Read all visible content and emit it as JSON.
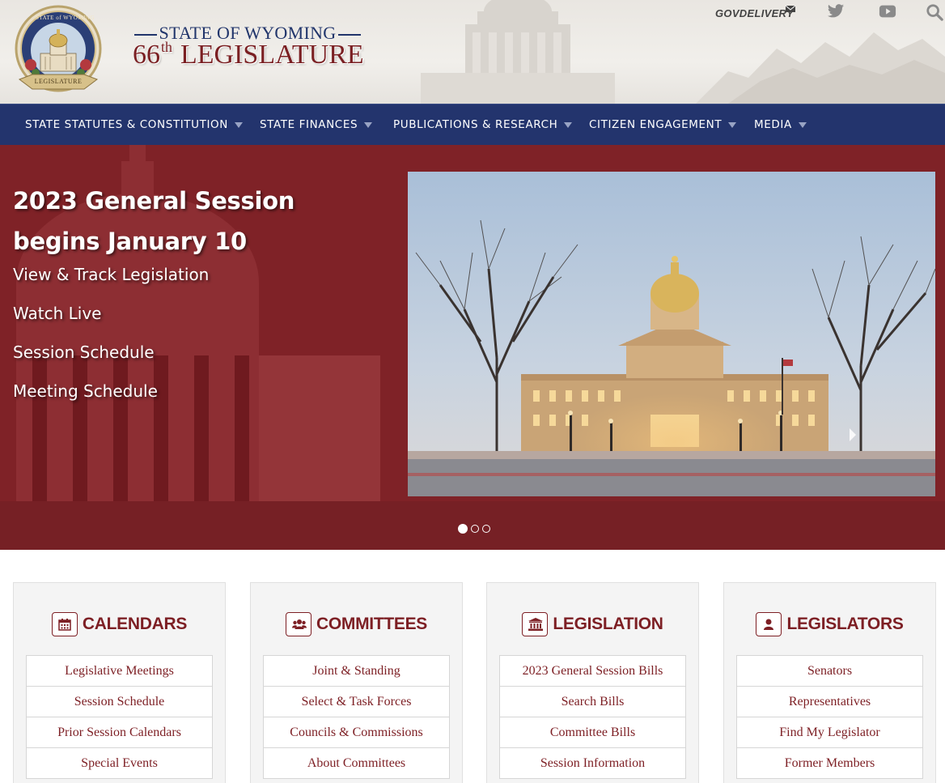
{
  "header": {
    "seal": {
      "top_text": "STATE of WYOMING",
      "banner_text": "LEGISLATURE"
    },
    "title_line1": "STATE OF WYOMING",
    "title_number": "66",
    "title_suffix": "th",
    "title_word": "LEGISLATURE",
    "govdelivery_label": "GOVDELIVERY",
    "icons": [
      "twitter-icon",
      "youtube-icon",
      "search-icon"
    ]
  },
  "nav": {
    "items": [
      {
        "label": "STATE STATUTES & CONSTITUTION"
      },
      {
        "label": "STATE FINANCES"
      },
      {
        "label": "PUBLICATIONS & RESEARCH"
      },
      {
        "label": "CITIZEN ENGAGEMENT"
      },
      {
        "label": "MEDIA"
      }
    ]
  },
  "hero": {
    "title": "2023 General Session begins January 10",
    "links": [
      "View & Track Legislation",
      "Watch Live",
      "Session Schedule",
      "Meeting Schedule"
    ],
    "slide_count": 3,
    "active_slide": 1
  },
  "cards": [
    {
      "title": "CALENDARS",
      "icon": "calendar-icon",
      "links": [
        "Legislative Meetings",
        "Session Schedule",
        "Prior Session Calendars",
        "Special Events"
      ]
    },
    {
      "title": "COMMITTEES",
      "icon": "users-icon",
      "links": [
        "Joint & Standing",
        "Select & Task Forces",
        "Councils & Commissions",
        "About Committees"
      ]
    },
    {
      "title": "LEGISLATION",
      "icon": "institution-icon",
      "links": [
        "2023 General Session Bills",
        "Search Bills",
        "Committee Bills",
        "Session Information"
      ]
    },
    {
      "title": "LEGISLATORS",
      "icon": "user-icon",
      "links": [
        "Senators",
        "Representatives",
        "Find My Legislator",
        "Former Members"
      ]
    }
  ],
  "colors": {
    "nav_bg": "#23346d",
    "hero_bg": "#7d1f24",
    "accent": "#7d1f24",
    "title_blue": "#21356b"
  }
}
